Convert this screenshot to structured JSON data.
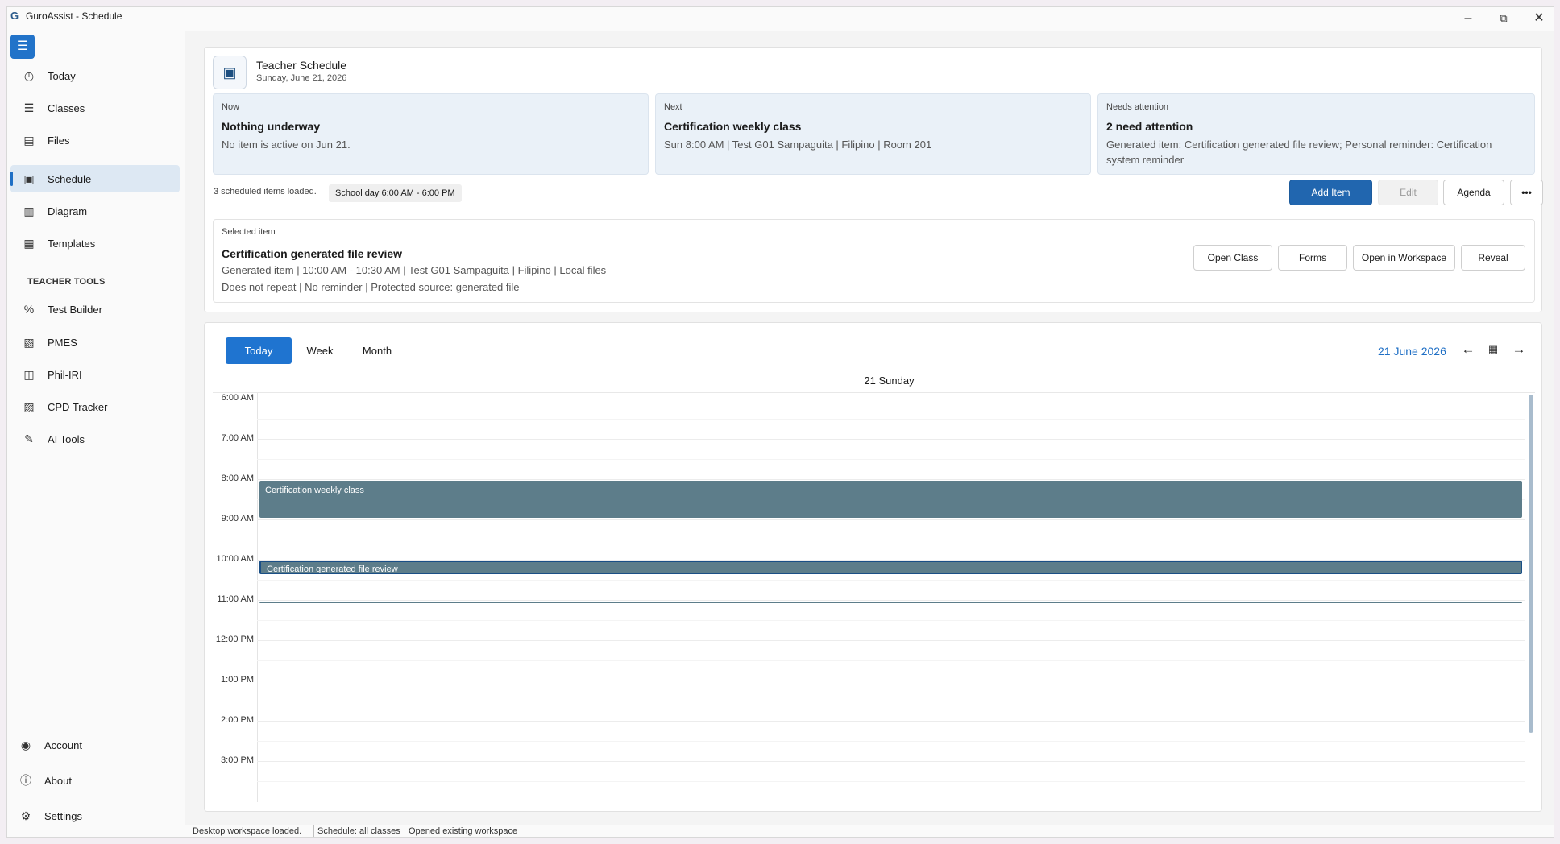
{
  "window": {
    "title": "GuroAssist - Schedule",
    "logo_glyph": "G",
    "controls": {
      "minimize": "–",
      "maximize": "⧉",
      "close": "✕"
    }
  },
  "sidebar": {
    "menu_icon": "☰",
    "items": [
      {
        "label": "Today",
        "icon": "clock-icon",
        "glyph": "◷"
      },
      {
        "label": "Classes",
        "icon": "list-icon",
        "glyph": "☰"
      },
      {
        "label": "Files",
        "icon": "file-icon",
        "glyph": "▤"
      },
      {
        "label": "Schedule",
        "icon": "calendar-check-icon",
        "glyph": "▣",
        "active": true
      },
      {
        "label": "Diagram",
        "icon": "diagram-icon",
        "glyph": "▥"
      },
      {
        "label": "Templates",
        "icon": "template-icon",
        "glyph": "▦"
      }
    ],
    "section_label": "TEACHER TOOLS",
    "tools": [
      {
        "label": "Test Builder",
        "icon": "test-builder-icon",
        "glyph": "%"
      },
      {
        "label": "PMES",
        "icon": "pmes-icon",
        "glyph": "▧"
      },
      {
        "label": "Phil-IRI",
        "icon": "book-icon",
        "glyph": "◫"
      },
      {
        "label": "CPD Tracker",
        "icon": "tracker-icon",
        "glyph": "▨"
      },
      {
        "label": "AI Tools",
        "icon": "magic-wand-icon",
        "glyph": "✎"
      }
    ],
    "footer": [
      {
        "label": "Account",
        "icon": "account-icon",
        "glyph": "◉"
      },
      {
        "label": "About",
        "icon": "info-icon",
        "glyph": "ⓘ"
      },
      {
        "label": "Settings",
        "icon": "gear-icon",
        "glyph": "⚙"
      }
    ]
  },
  "header": {
    "title": "Teacher Schedule",
    "date": "Sunday, June 21, 2026",
    "icon_glyph": "▣"
  },
  "summary": {
    "now": {
      "caption": "Now",
      "title": "Nothing underway",
      "text": "No item is active on Jun 21."
    },
    "next": {
      "caption": "Next",
      "title": "Certification weekly class",
      "text": "Sun 8:00 AM | Test G01 Sampaguita | Filipino | Room 201"
    },
    "attention": {
      "caption": "Needs attention",
      "title": "2 need attention",
      "text": "Generated item: Certification generated file review; Personal reminder: Certification system reminder"
    }
  },
  "status_row": {
    "loaded": "3 scheduled items loaded.",
    "school_day": "School day 6:00 AM - 6:00 PM"
  },
  "actions": {
    "add_item": "Add Item",
    "edit": "Edit",
    "agenda": "Agenda",
    "more": "•••"
  },
  "selected": {
    "caption": "Selected item",
    "title": "Certification generated file review",
    "line1": "Generated item | 10:00 AM - 10:30 AM | Test G01 Sampaguita | Filipino | Local files",
    "line2": "Does not repeat | No reminder | Protected source: generated file",
    "buttons": {
      "open_class": "Open Class",
      "forms": "Forms",
      "open_workspace": "Open in Workspace",
      "reveal": "Reveal"
    }
  },
  "calendar": {
    "views": {
      "today": "Today",
      "week": "Week",
      "month": "Month"
    },
    "active_view": "Today",
    "current_date": "21 June 2026",
    "prev_glyph": "←",
    "cal_glyph": "▦",
    "next_glyph": "→",
    "day_header": "21 Sunday",
    "times": [
      "6:00 AM",
      "7:00 AM",
      "8:00 AM",
      "9:00 AM",
      "10:00 AM",
      "11:00 AM",
      "12:00 PM",
      "1:00 PM",
      "2:00 PM",
      "3:00 PM"
    ],
    "events": [
      {
        "label": "Certification weekly class",
        "start": "8:00 AM",
        "end": "9:00 AM",
        "color": "#5d7d8a"
      },
      {
        "label": "Certification generated file review",
        "start": "10:00 AM",
        "end": "10:30 AM",
        "color": "#5d7d8a",
        "selected": true
      },
      {
        "label": "",
        "start": "11:00 AM",
        "end": "11:00 AM",
        "color": "#5d7d8a"
      }
    ]
  },
  "statusbar": {
    "workspace": "Desktop workspace loaded.",
    "schedule": "Schedule: all classes",
    "opened": "Opened existing workspace"
  },
  "colors": {
    "accent": "#1f74d0",
    "primary_button": "#2166af",
    "event": "#5d7d8a",
    "selected_border": "#1a4f86"
  }
}
